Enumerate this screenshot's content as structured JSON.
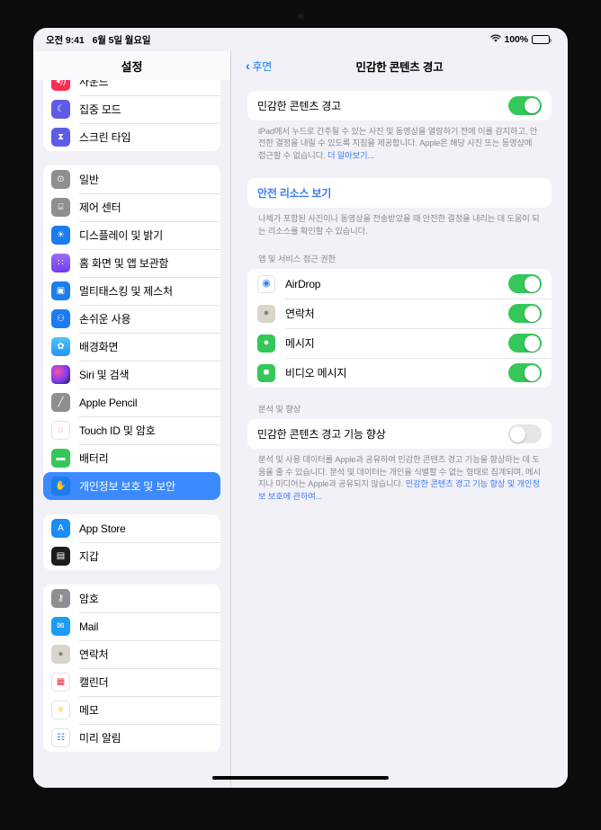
{
  "status_bar": {
    "time": "오전 9:41",
    "date": "6월 5일 월요일",
    "wifi_icon": "wifi-icon",
    "battery_percent": "100%"
  },
  "sidebar": {
    "title": "설정",
    "groups": [
      {
        "clipped": true,
        "items": [
          {
            "label": "사운드",
            "icon": "speaker-icon",
            "icon_bg": "#fb2e53",
            "glyph": "◂))"
          },
          {
            "label": "집중 모드",
            "icon": "moon-icon",
            "icon_bg": "#5e5ce6",
            "glyph": "☾"
          },
          {
            "label": "스크린 타임",
            "icon": "hourglass-icon",
            "icon_bg": "#5e5ce6",
            "glyph": "⧗"
          }
        ]
      },
      {
        "clipped": false,
        "items": [
          {
            "label": "일반",
            "icon": "gear-icon",
            "icon_bg": "#8e8e93",
            "glyph": "⊙"
          },
          {
            "label": "제어 센터",
            "icon": "control-center-icon",
            "icon_bg": "#8e8e93",
            "glyph": "⌸"
          },
          {
            "label": "디스플레이 및 밝기",
            "icon": "brightness-icon",
            "icon_bg": "#1b7cf0",
            "glyph": "☀"
          },
          {
            "label": "홈 화면 및 앱 보관함",
            "icon": "home-screen-icon",
            "icon_bg": "#7a4df0",
            "glyph": "∷"
          },
          {
            "label": "멀티태스킹 및 제스처",
            "icon": "multitasking-icon",
            "icon_bg": "#1b7cf0",
            "glyph": "▣"
          },
          {
            "label": "손쉬운 사용",
            "icon": "accessibility-icon",
            "icon_bg": "#1b7cf0",
            "glyph": "⚇"
          },
          {
            "label": "배경화면",
            "icon": "wallpaper-icon",
            "icon_bg": "#41b8f5",
            "glyph": "✿"
          },
          {
            "label": "Siri 및 검색",
            "icon": "siri-icon",
            "icon_bg": "#2b2b35",
            "glyph": ""
          },
          {
            "label": "Apple Pencil",
            "icon": "pencil-icon",
            "icon_bg": "#8e8e93",
            "glyph": "╱"
          },
          {
            "label": "Touch ID 및 암호",
            "icon": "touch-id-icon",
            "icon_bg": "#ffffff",
            "glyph": "◌"
          },
          {
            "label": "배터리",
            "icon": "battery-icon",
            "icon_bg": "#34c759",
            "glyph": "▬"
          },
          {
            "label": "개인정보 보호 및 보안",
            "icon": "hand-raised-icon",
            "icon_bg": "#1b7cf0",
            "glyph": "✋",
            "selected": true
          }
        ]
      },
      {
        "clipped": false,
        "items": [
          {
            "label": "App Store",
            "icon": "app-store-icon",
            "icon_bg": "#1b8cf5",
            "glyph": "A"
          },
          {
            "label": "지갑",
            "icon": "wallet-icon",
            "icon_bg": "#1c1c1e",
            "glyph": "▤"
          }
        ]
      },
      {
        "clipped": false,
        "items": [
          {
            "label": "암호",
            "icon": "key-icon",
            "icon_bg": "#8e8e93",
            "glyph": "⚷"
          },
          {
            "label": "Mail",
            "icon": "mail-icon",
            "icon_bg": "#1b9cf5",
            "glyph": "✉"
          },
          {
            "label": "연락처",
            "icon": "contacts-icon",
            "icon_bg": "#d9d5cc",
            "glyph": "●"
          },
          {
            "label": "캘린더",
            "icon": "calendar-icon",
            "icon_bg": "#ffffff",
            "glyph": "▦"
          },
          {
            "label": "메모",
            "icon": "notes-icon",
            "icon_bg": "#ffffff",
            "glyph": "≡"
          },
          {
            "label": "미리 알림",
            "icon": "reminders-icon",
            "icon_bg": "#ffffff",
            "glyph": "☷"
          }
        ]
      }
    ]
  },
  "detail": {
    "back_label": "후면",
    "title": "민감한 콘텐츠 경고",
    "main_toggle": {
      "label": "민감한 콘텐츠 경고",
      "state": "on"
    },
    "main_footnote": {
      "text": "iPad에서 누드로 간주될 수 있는 사진 및 동영상을 열람하기 전에 이를 감지하고, 안전한 결정을 내릴 수 있도록 지침을 제공합니다. Apple은 해당 사진 또는 동영상에 접근할 수 없습니다. ",
      "link": "더 알아보기..."
    },
    "safety_link_row": {
      "label": "안전 리소스 보기"
    },
    "safety_footnote": {
      "text": "나체가 포함된 사진이나 동영상을 전송받았을 때 안전한 결정을 내리는 데 도움이 되는 리소스를 확인할 수 있습니다."
    },
    "apps_section": {
      "header": "앱 및 서비스 접근 권한",
      "rows": [
        {
          "label": "AirDrop",
          "icon": "airdrop-icon",
          "icon_bg": "#ffffff",
          "glyph": "◉",
          "state": "on"
        },
        {
          "label": "연락처",
          "icon": "contacts-icon",
          "icon_bg": "#d9d5cc",
          "glyph": "●",
          "state": "on"
        },
        {
          "label": "메시지",
          "icon": "messages-icon",
          "icon_bg": "#34c759",
          "glyph": "●",
          "state": "on"
        },
        {
          "label": "비디오 메시지",
          "icon": "video-message-icon",
          "icon_bg": "#34c759",
          "glyph": "■",
          "state": "on"
        }
      ]
    },
    "analytics_section": {
      "header": "분석 및 향상",
      "toggle": {
        "label": "민감한 콘텐츠 경고 기능 향상",
        "state": "off"
      },
      "footnote": {
        "text": "분석 및 사용 데이터를 Apple과 공유하여 민감한 콘텐츠 경고 기능을 향상하는 데 도움을 줄 수 있습니다. 분석 및 데이터는 개인을 식별할 수 없는 형태로 집계되며, 메시지나 미디어는 Apple과 공유되지 않습니다. ",
        "link": "민감한 콘텐츠 경고 기능 향상 및 개인정보 보호에 관하여..."
      }
    }
  }
}
